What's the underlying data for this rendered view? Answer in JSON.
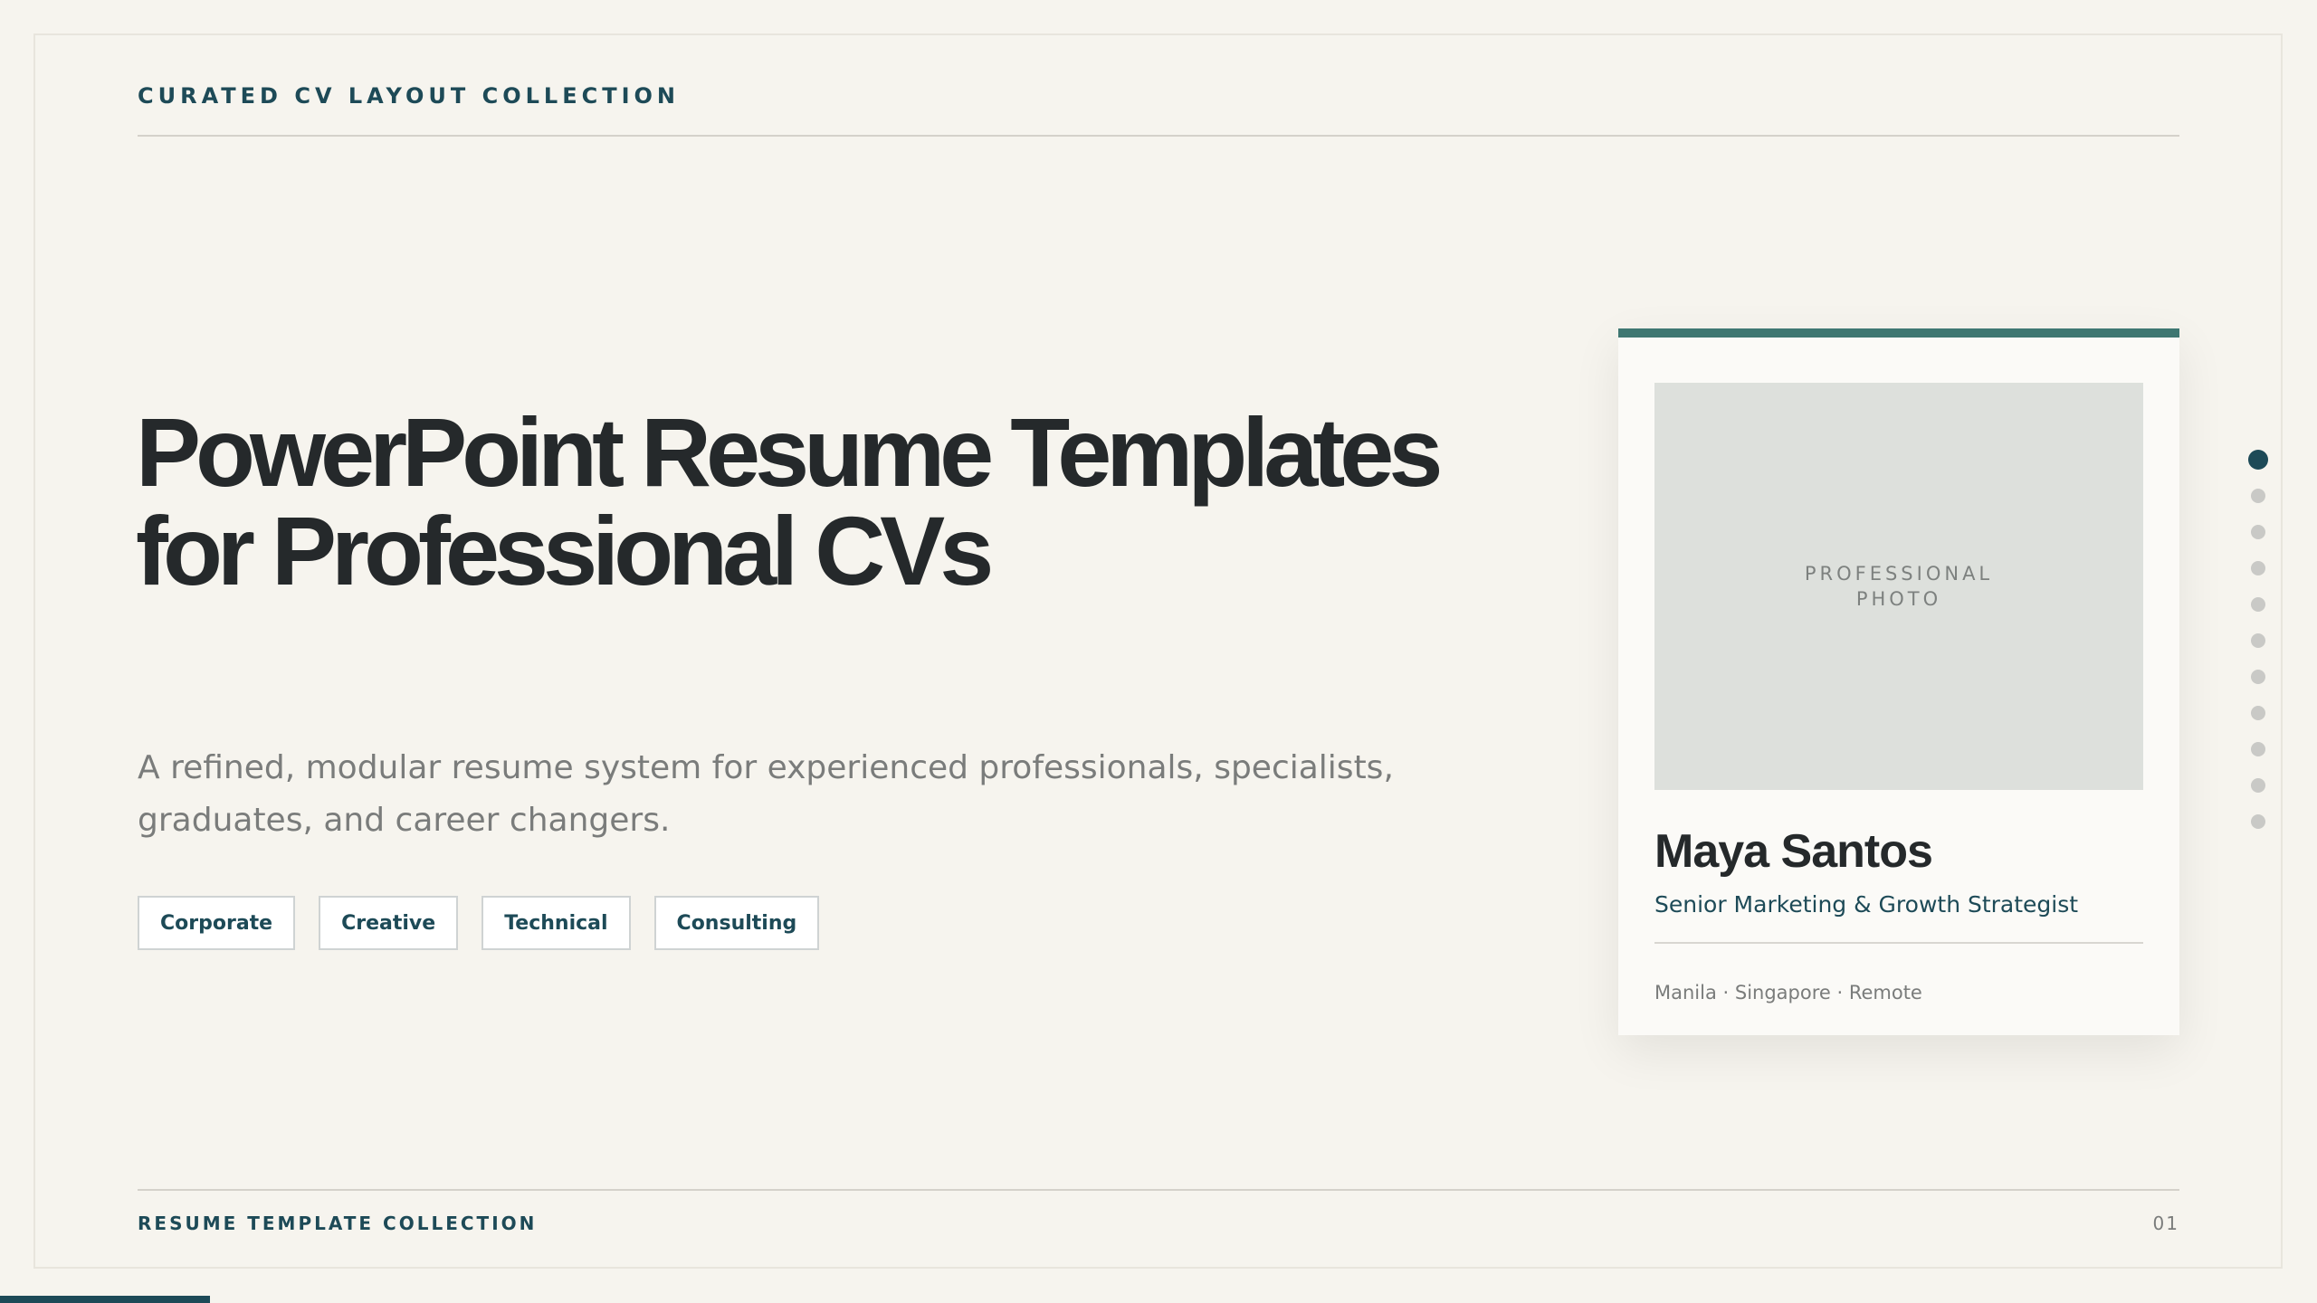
{
  "header": {
    "eyebrow": "CURATED CV LAYOUT COLLECTION"
  },
  "hero": {
    "title": "PowerPoint Resume Templates for Professional CVs",
    "subtitle": "A refined, modular resume system for experienced professionals, specialists, graduates, and career changers.",
    "tags": [
      "Corporate",
      "Creative",
      "Technical",
      "Consulting"
    ]
  },
  "profile_card": {
    "photo_placeholder": "PROFESSIONAL PHOTO",
    "name": "Maya Santos",
    "role": "Senior Marketing & Growth Strategist",
    "location": "Manila · Singapore · Remote",
    "accent_color": "#3e7772"
  },
  "navigation": {
    "slide_count": 11,
    "active_slide": 1
  },
  "footer": {
    "label": "RESUME TEMPLATE COLLECTION",
    "page_number": "01"
  },
  "colors": {
    "background": "#f6f4ee",
    "brand_dark": "#1d4a57",
    "text_dark": "#25292b",
    "muted": "#7a7c7b"
  }
}
